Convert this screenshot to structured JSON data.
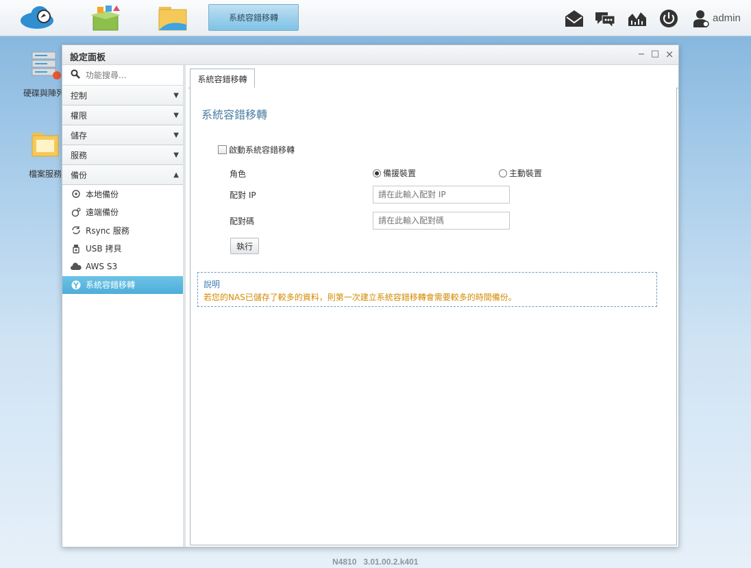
{
  "taskbar": {
    "active_tab": "系統容錯移轉",
    "user": "admin"
  },
  "desktop": {
    "icons": [
      {
        "label": "硬碟與陣列"
      },
      {
        "label": "檔案服務"
      }
    ]
  },
  "window": {
    "title": "設定面板",
    "controls": {
      "minimize": "−",
      "maximize": "□",
      "close": "×"
    }
  },
  "sidebar": {
    "search_placeholder": "功能搜尋...",
    "categories": [
      {
        "label": "控制",
        "arrow": "▼"
      },
      {
        "label": "權限",
        "arrow": "▼"
      },
      {
        "label": "儲存",
        "arrow": "▼"
      },
      {
        "label": "服務",
        "arrow": "▼"
      },
      {
        "label": "備份",
        "arrow": "▲"
      }
    ],
    "backup_items": [
      {
        "label": "本地備份"
      },
      {
        "label": "遠端備份"
      },
      {
        "label": "Rsync 服務"
      },
      {
        "label": "USB 拷貝"
      },
      {
        "label": "AWS S3"
      },
      {
        "label": "系統容錯移轉"
      }
    ]
  },
  "main": {
    "tab_label": "系統容錯移轉",
    "page_title": "系統容錯移轉",
    "enable_label": "啟動系統容錯移轉",
    "role_label": "角色",
    "role_options": [
      {
        "label": "備援裝置",
        "selected": true
      },
      {
        "label": "主動裝置",
        "selected": false
      }
    ],
    "pair_ip_label": "配對 IP",
    "pair_ip_placeholder": "請在此輸入配對 IP",
    "pair_code_label": "配對碼",
    "pair_code_placeholder": "請在此輸入配對碼",
    "execute_label": "執行",
    "note_title": "說明",
    "note_body": "若您的NAS已儲存了較多的資料，則第一次建立系統容錯移轉會需要較多的時間備份。"
  },
  "footer": {
    "version": "N4810   3.01.00.2.k401"
  }
}
